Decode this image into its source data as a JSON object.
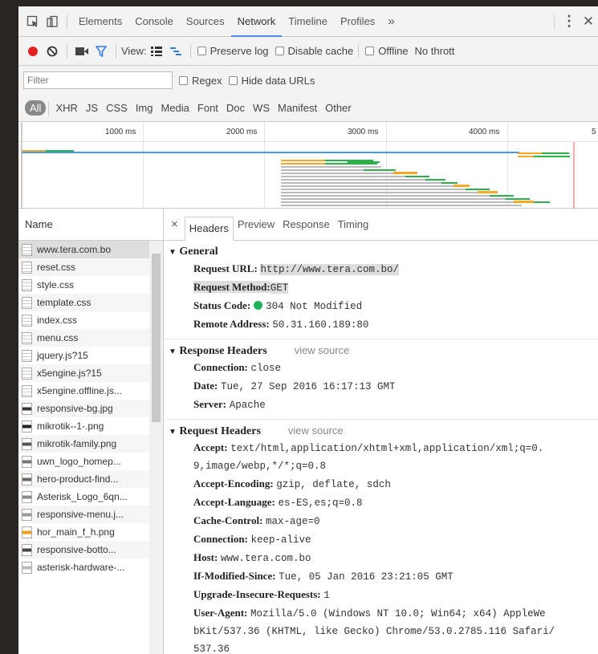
{
  "tabs": [
    "Elements",
    "Console",
    "Sources",
    "Network",
    "Timeline",
    "Profiles"
  ],
  "active_tab": "Network",
  "more_tabs": "»",
  "toolbar": {
    "view_label": "View:",
    "preserve_log": "Preserve log",
    "disable_cache": "Disable cache",
    "offline": "Offline",
    "throttle": "No thrott"
  },
  "filter": {
    "placeholder": "Filter",
    "regex": "Regex",
    "hide_data_urls": "Hide data URLs"
  },
  "type_filters": [
    "All",
    "XHR",
    "JS",
    "CSS",
    "Img",
    "Media",
    "Font",
    "Doc",
    "WS",
    "Manifest",
    "Other"
  ],
  "timeline": {
    "ticks": [
      "1000 ms",
      "2000 ms",
      "3000 ms",
      "4000 ms",
      "5"
    ]
  },
  "requests": {
    "header": "Name",
    "items": [
      {
        "name": "www.tera.com.bo",
        "icon": "document-icon"
      },
      {
        "name": "reset.css",
        "icon": "css-file-icon"
      },
      {
        "name": "style.css",
        "icon": "css-file-icon"
      },
      {
        "name": "template.css",
        "icon": "css-file-icon"
      },
      {
        "name": "index.css",
        "icon": "css-file-icon"
      },
      {
        "name": "menu.css",
        "icon": "css-file-icon"
      },
      {
        "name": "jquery.js?15",
        "icon": "js-file-icon"
      },
      {
        "name": "x5engine.js?15",
        "icon": "js-file-icon"
      },
      {
        "name": "x5engine.offline.js...",
        "icon": "js-file-icon"
      },
      {
        "name": "responsive-bg.jpg",
        "icon": "image-thumb-icon"
      },
      {
        "name": "mikrotik--1-.png",
        "icon": "image-thumb-icon"
      },
      {
        "name": "mikrotik-family.png",
        "icon": "image-thumb-icon"
      },
      {
        "name": "uwn_logo_homep...",
        "icon": "image-thumb-icon"
      },
      {
        "name": "hero-product-find...",
        "icon": "image-thumb-icon"
      },
      {
        "name": "Asterisk_Logo_6qn...",
        "icon": "image-thumb-icon"
      },
      {
        "name": "responsive-menu.j...",
        "icon": "image-thumb-icon"
      },
      {
        "name": "hor_main_f_h.png",
        "icon": "image-thumb-icon"
      },
      {
        "name": "responsive-botto...",
        "icon": "image-thumb-icon"
      },
      {
        "name": "asterisk-hardware-...",
        "icon": "image-thumb-icon"
      }
    ]
  },
  "detail": {
    "close": "×",
    "tabs": [
      "Headers",
      "Preview",
      "Response",
      "Timing"
    ],
    "active_tab": "Headers",
    "general": {
      "title": "General",
      "request_url_k": "Request URL:",
      "request_url_v": "http://www.tera.com.bo/",
      "request_method_k": "Request Method:",
      "request_method_v": "GET",
      "status_code_k": "Status Code:",
      "status_code_v": "304 Not Modified",
      "remote_address_k": "Remote Address:",
      "remote_address_v": "50.31.160.189:80"
    },
    "response_headers": {
      "title": "Response Headers",
      "view_source": "view source",
      "items": [
        {
          "k": "Connection:",
          "v": "close"
        },
        {
          "k": "Date:",
          "v": "Tue, 27 Sep 2016 16:17:13 GMT"
        },
        {
          "k": "Server:",
          "v": "Apache"
        }
      ]
    },
    "request_headers": {
      "title": "Request Headers",
      "view_source": "view source",
      "accept_k": "Accept:",
      "accept_v": "text/html,application/xhtml+xml,application/xml;q=0.",
      "accept_v2": "9,image/webp,*/*;q=0.8",
      "items": [
        {
          "k": "Accept-Encoding:",
          "v": "gzip, deflate, sdch"
        },
        {
          "k": "Accept-Language:",
          "v": "es-ES,es;q=0.8"
        },
        {
          "k": "Cache-Control:",
          "v": "max-age=0"
        },
        {
          "k": "Connection:",
          "v": "keep-alive"
        },
        {
          "k": "Host:",
          "v": "www.tera.com.bo"
        },
        {
          "k": "If-Modified-Since:",
          "v": "Tue, 05 Jan 2016 23:21:05 GMT"
        },
        {
          "k": "Upgrade-Insecure-Requests:",
          "v": "1"
        }
      ],
      "ua_k": "User-Agent:",
      "ua_v": "Mozilla/5.0 (Windows NT 10.0; Win64; x64) AppleWe",
      "ua_v2": "bKit/537.36 (KHTML, like Gecko) Chrome/53.0.2785.116 Safari/",
      "ua_v3": "537.36"
    }
  }
}
